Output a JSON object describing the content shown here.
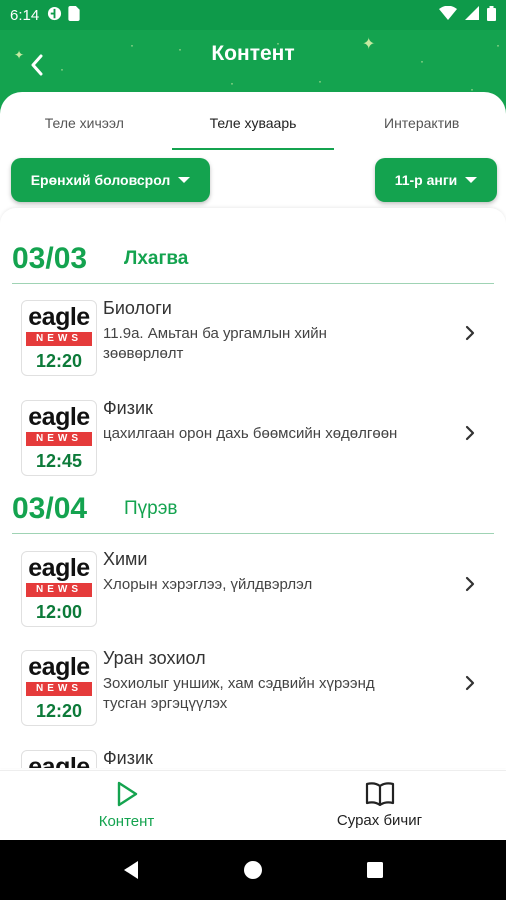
{
  "status_bar": {
    "time": "6:14"
  },
  "header": {
    "title": "Контент"
  },
  "tabs": [
    {
      "label": "Теле хичээл"
    },
    {
      "label": "Теле хуваарь"
    },
    {
      "label": "Интерактив"
    }
  ],
  "filters": {
    "level": "Ерөнхий боловсрол",
    "grade": "11-р анги"
  },
  "logo": {
    "word": "eagle",
    "band": "NEWS"
  },
  "days": [
    {
      "date": "03/03",
      "weekday": "Лхагва",
      "items": [
        {
          "time": "12:20",
          "subject": "Биологи",
          "desc": "11.9а. Амьтан ба ургамлын хийн зөөвөрлөлт"
        },
        {
          "time": "12:45",
          "subject": "Физик",
          "desc": "цахилгаан орон дахь бөөмсийн хөдөлгөөн"
        }
      ]
    },
    {
      "date": "03/04",
      "weekday": "Пүрэв",
      "items": [
        {
          "time": "12:00",
          "subject": "Хими",
          "desc": "Хлорын хэрэглээ, үйлдвэрлэл"
        },
        {
          "time": "12:20",
          "subject": "Уран зохиол",
          "desc": " Зохиолыг уншиж, хам сэдвийн хүрээнд тусган эргэцүүлэх"
        },
        {
          "time": "",
          "subject": "Физик",
          "desc": ""
        }
      ]
    }
  ],
  "bottom_nav": [
    {
      "label": "Контент",
      "icon": "play-icon"
    },
    {
      "label": "Сурах бичиг",
      "icon": "book-icon"
    }
  ],
  "colors": {
    "primary": "#14a34f",
    "status_bar": "#0e9a4a",
    "news_red": "#e53b3b"
  }
}
